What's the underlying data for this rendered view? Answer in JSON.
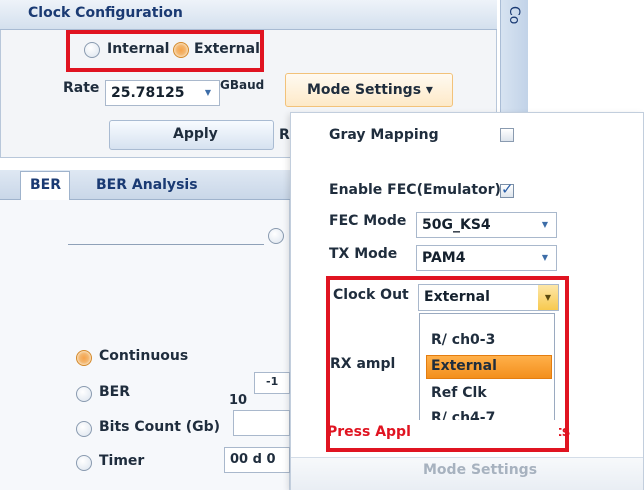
{
  "clock_configuration": {
    "title": "Clock Configuration",
    "internal_label": "Internal",
    "external_label": "External",
    "rate_label": "Rate",
    "rate_value": "25.78125",
    "rate_unit": "GBaud",
    "apply_label": "Apply",
    "re_label": "Re"
  },
  "right_panel": {
    "vertical_label": "Co"
  },
  "mode_settings_button": "Mode Settings ▾",
  "tabs": [
    "BER",
    "BER Analysis"
  ],
  "ber_panel": {
    "continuous_label": "Continuous",
    "ber_label": "BER",
    "ber_base": "10",
    "ber_exponent": "-1",
    "bits_count_label": "Bits Count (Gb)",
    "timer_label": "Timer",
    "timer_value": "00 d 0"
  },
  "mode_settings_popup": {
    "gray_mapping_label": "Gray Mapping",
    "enable_fec_label": "Enable FEC(Emulator)",
    "fec_mode_label": "FEC Mode",
    "fec_mode_value": "50G_KS4",
    "tx_mode_label": "TX Mode",
    "tx_mode_value": "PAM4",
    "clock_out_label": "Clock Out",
    "clock_out_value": "External",
    "clock_out_options": [
      "R/ ch0-3",
      "External",
      "Ref Clk",
      "R/ ch4-7"
    ],
    "rx_ampl_label": "RX ampl",
    "warning_text": "Press Apply to take the effects",
    "footer_label": "Mode Settings"
  },
  "colors": {
    "accent_orange": "#f39a3c",
    "highlight_red": "#e01421",
    "header_blue": "#1a3a73"
  }
}
